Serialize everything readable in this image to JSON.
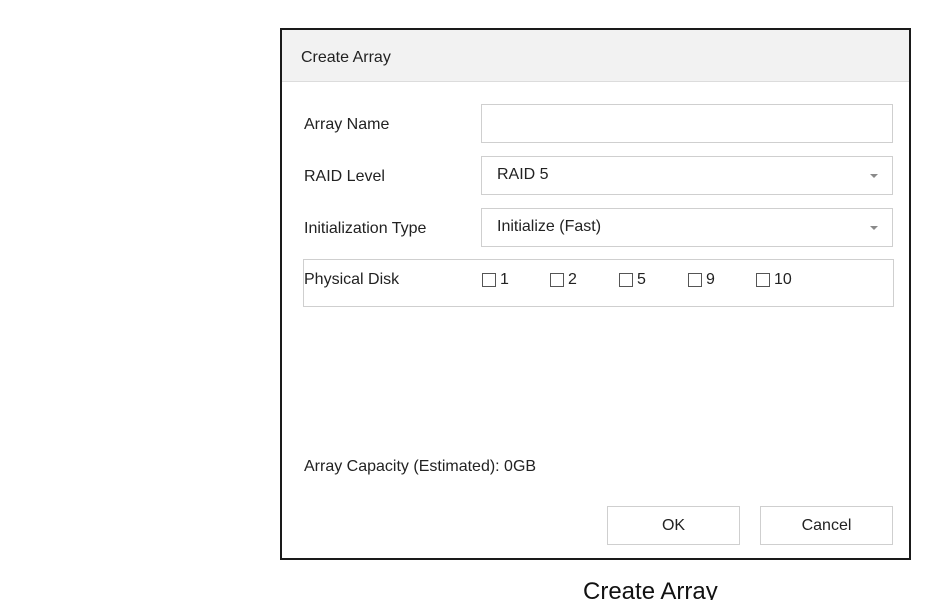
{
  "dialog": {
    "title": "Create Array",
    "fields": {
      "array_name": {
        "label": "Array Name",
        "value": "",
        "placeholder": ""
      },
      "raid_level": {
        "label": "RAID Level",
        "value": "RAID 5"
      },
      "init_type": {
        "label": "Initialization Type",
        "value": "Initialize (Fast)"
      }
    },
    "physical_disk": {
      "label": "Physical Disk",
      "disks": [
        {
          "number": "1",
          "checked": false
        },
        {
          "number": "2",
          "checked": false
        },
        {
          "number": "5",
          "checked": false
        },
        {
          "number": "9",
          "checked": false
        },
        {
          "number": "10",
          "checked": false
        }
      ]
    },
    "capacity_text": "Array Capacity (Estimated): 0GB",
    "buttons": {
      "ok": "OK",
      "cancel": "Cancel"
    }
  },
  "caption": "Create Array"
}
